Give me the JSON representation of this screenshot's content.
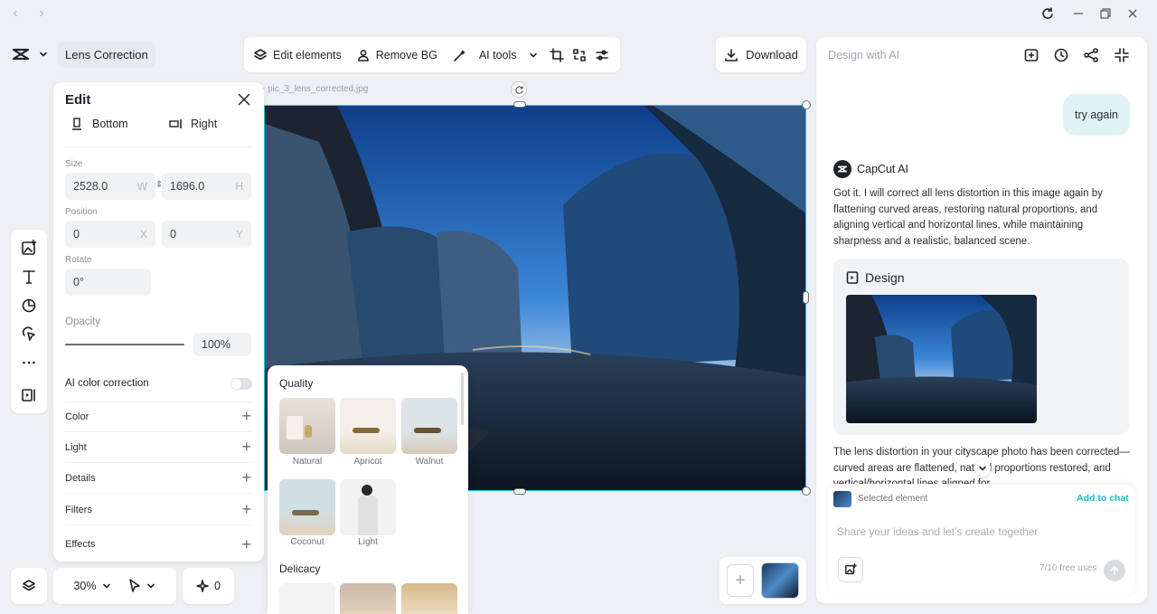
{
  "titlebar": {
    "back_icon": "chevron-left-icon",
    "forward_icon": "chevron-right-icon",
    "window_controls": [
      "refresh-icon",
      "minimize-icon",
      "restore-icon",
      "close-icon"
    ]
  },
  "project": {
    "name": "Lens Correction"
  },
  "toolbar": {
    "edit_elements": "Edit elements",
    "remove_bg": "Remove BG",
    "ai_tools": "AI tools",
    "download": "Download"
  },
  "canvas": {
    "filename": "pic_3_lens_corrected.jpg"
  },
  "edit_panel": {
    "title": "Edit",
    "align_bottom": "Bottom",
    "align_right": "Right",
    "size_label": "Size",
    "width": "2528.0",
    "width_suffix": "W",
    "height": "1696.0",
    "height_suffix": "H",
    "position_label": "Position",
    "pos_x": "0",
    "pos_x_suffix": "X",
    "pos_y": "0",
    "pos_y_suffix": "Y",
    "rotate_label": "Rotate",
    "rotate": "0°",
    "opacity_label": "Opacity",
    "opacity": "100%",
    "opacity_fraction": 1.0,
    "ai_color_correction": "AI color correction",
    "ai_color_correction_on": false,
    "sections": [
      "Color",
      "Light",
      "Details",
      "Filters",
      "Effects"
    ]
  },
  "filters": {
    "quality_title": "Quality",
    "quality_items": [
      "Natural",
      "Apricot",
      "Walnut",
      "Coconut",
      "Light"
    ],
    "delicacy_title": "Delicacy"
  },
  "bottom": {
    "zoom": "30%",
    "count": "0"
  },
  "ai_panel": {
    "title": "Design with AI",
    "user_message": "try again",
    "assistant_name": "CapCut AI",
    "assistant_message": "Got it. I will correct all lens distortion in this image again by flattening curved areas, restoring natural proportions, and aligning vertical and horizontal lines, while maintaining sharpness and a realistic, balanced scene.",
    "design_card_title": "Design",
    "result_message": "The lens distortion in your cityscape photo has been corrected—curved areas are flattened, natural proportions restored, and vertical/horizontal lines aligned for",
    "selected_element": "Selected element",
    "add_to_chat": "Add to chat",
    "input_placeholder": "Share your ideas and let's create together",
    "free_uses": "7/10 free uses"
  },
  "colors": {
    "accent_cyan": "#1ec6e0",
    "panel_bg": "#ffffff",
    "app_bg": "#eef0f3",
    "bubble_bg": "#dff2f4",
    "add_to_chat": "#1ab6cf"
  }
}
